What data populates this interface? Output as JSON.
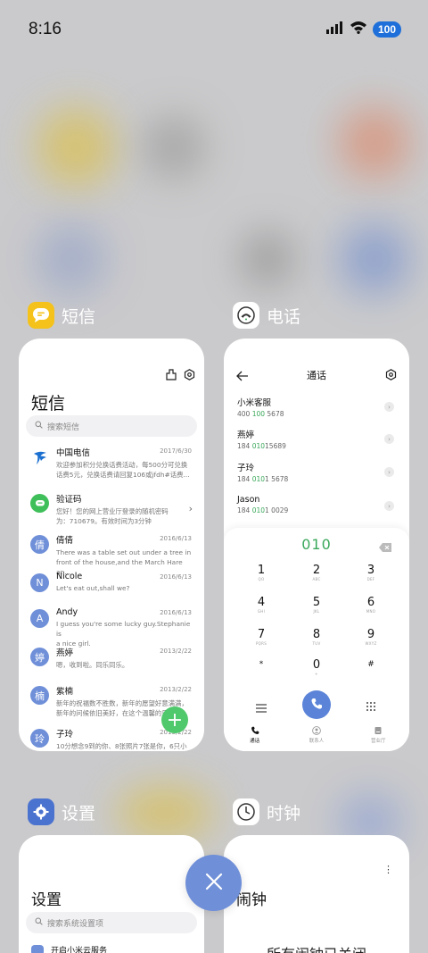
{
  "status_bar": {
    "time": "8:16",
    "battery": "100"
  },
  "apps": {
    "messages": {
      "name": "短信",
      "screen_title": "短信",
      "search_placeholder": "搜索短信",
      "threads": [
        {
          "name": "中国电信",
          "date": "2017/6/30",
          "preview": "欢迎参加积分兑换话费活动，每500分可兑换\n话费5元，兑换话费请回复106或jfdh#话费...",
          "avatar": "telecom-logo",
          "color": "#1a6fd0"
        },
        {
          "name": "验证码",
          "date": "",
          "preview": "您好！您的网上营业厅登录的随机密码\n为：710679。有效时间为3分钟",
          "avatar": "chat-bubble",
          "color": "#3fbf5a"
        },
        {
          "name": "倩倩",
          "date": "2016/6/13",
          "preview": "There was a table set out under a tree in\nfront of the house,and the March Hare an...",
          "avatar": "倩",
          "color": "#6f8fd8"
        },
        {
          "name": "Nicole",
          "date": "2016/6/13",
          "preview": "Let's eat out,shall we?",
          "avatar": "N",
          "color": "#6f8fd8"
        },
        {
          "name": "Andy",
          "date": "2016/6/13",
          "preview": "I guess you're some lucky guy.Stephanie is\na nice girl.",
          "avatar": "A",
          "color": "#6f8fd8"
        },
        {
          "name": "燕婷",
          "date": "2013/2/22",
          "preview": "嗯，收到啦。同乐同乐。",
          "avatar": "婷",
          "color": "#6f8fd8"
        },
        {
          "name": "紫楠",
          "date": "2013/2/22",
          "preview": "新年的祝福数不胜数，新年的愿望好意满满，\n新年的问候依旧美好，在这个温馨的日子里...",
          "avatar": "楠",
          "color": "#6f8fd8"
        },
        {
          "name": "子玲",
          "date": "2013/2/22",
          "preview": "10分想念9到的你、8张照片7张是你，6只小\n狗5只像你，4段爱3人把我，2只看外1张...",
          "avatar": "玲",
          "color": "#6f8fd8"
        }
      ]
    },
    "phone": {
      "name": "电话",
      "screen_title": "通话",
      "contacts": [
        {
          "name": "小米客服",
          "num_a": "400 ",
          "num_hl": "100",
          "num_b": " 5678"
        },
        {
          "name": "燕婷",
          "num_a": "184 ",
          "num_hl": "010",
          "num_b": "15689"
        },
        {
          "name": "子玲",
          "num_a": "184 ",
          "num_hl": "010",
          "num_b": "1 5678"
        },
        {
          "name": "Jason",
          "num_a": "184 ",
          "num_hl": "010",
          "num_b": "1 0029"
        }
      ],
      "dial_input": "010",
      "keys": [
        {
          "num": "1",
          "sub": "QO"
        },
        {
          "num": "2",
          "sub": "ABC"
        },
        {
          "num": "3",
          "sub": "DEF"
        },
        {
          "num": "4",
          "sub": "GHI"
        },
        {
          "num": "5",
          "sub": "JKL"
        },
        {
          "num": "6",
          "sub": "MNO"
        },
        {
          "num": "7",
          "sub": "PQRS"
        },
        {
          "num": "8",
          "sub": "TUV"
        },
        {
          "num": "9",
          "sub": "WXYZ"
        },
        {
          "num": "*",
          "sub": ""
        },
        {
          "num": "0",
          "sub": "+"
        },
        {
          "num": "#",
          "sub": ""
        }
      ],
      "tabs": [
        "通话",
        "联系人",
        "营业厅"
      ]
    },
    "settings": {
      "name": "设置",
      "screen_title": "设置",
      "search_placeholder": "搜索系统设置项",
      "first_item": "开启小米云服务"
    },
    "clock": {
      "name": "时钟",
      "screen_title": "闹钟",
      "empty_text": "所有闹钟已关闭"
    }
  },
  "colors": {
    "accent_blue": "#6f8fd8",
    "green": "#3aa85a",
    "battery": "#1e6fd9"
  }
}
